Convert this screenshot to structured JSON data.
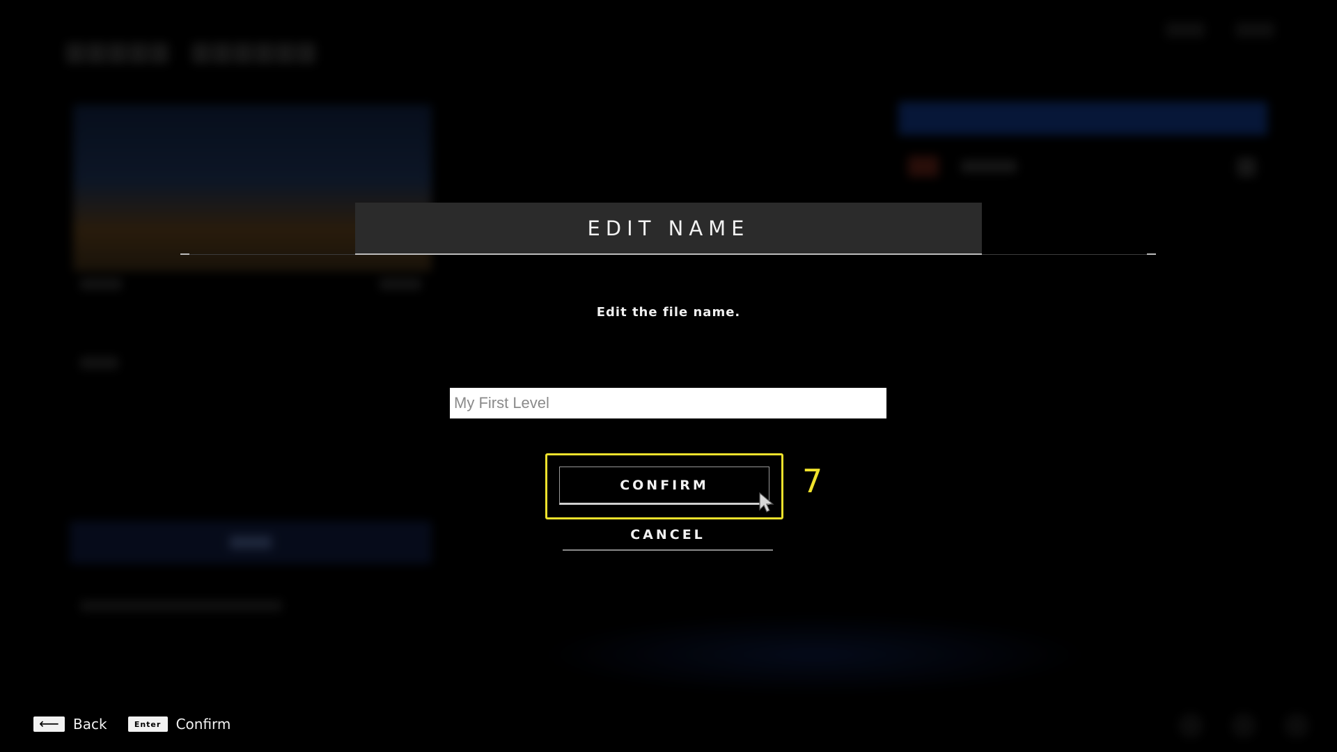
{
  "background": {
    "note_visible_text": ""
  },
  "dialog": {
    "title": "EDIT NAME",
    "subtitle": "Edit the file name.",
    "name_input": {
      "value": "My First Level",
      "placeholder": ""
    },
    "confirm_label": "CONFIRM",
    "cancel_label": "CANCEL",
    "badge_number": "7",
    "accent_color": "#f0e22c"
  },
  "footer": {
    "back_key_glyph": "⟵",
    "back_label": "Back",
    "enter_key_label": "Enter",
    "confirm_label": "Confirm"
  },
  "icons": {
    "cursor": "mouse-pointer-icon",
    "back_key": "back-arrow-key-icon",
    "enter_key": "enter-key-icon"
  }
}
